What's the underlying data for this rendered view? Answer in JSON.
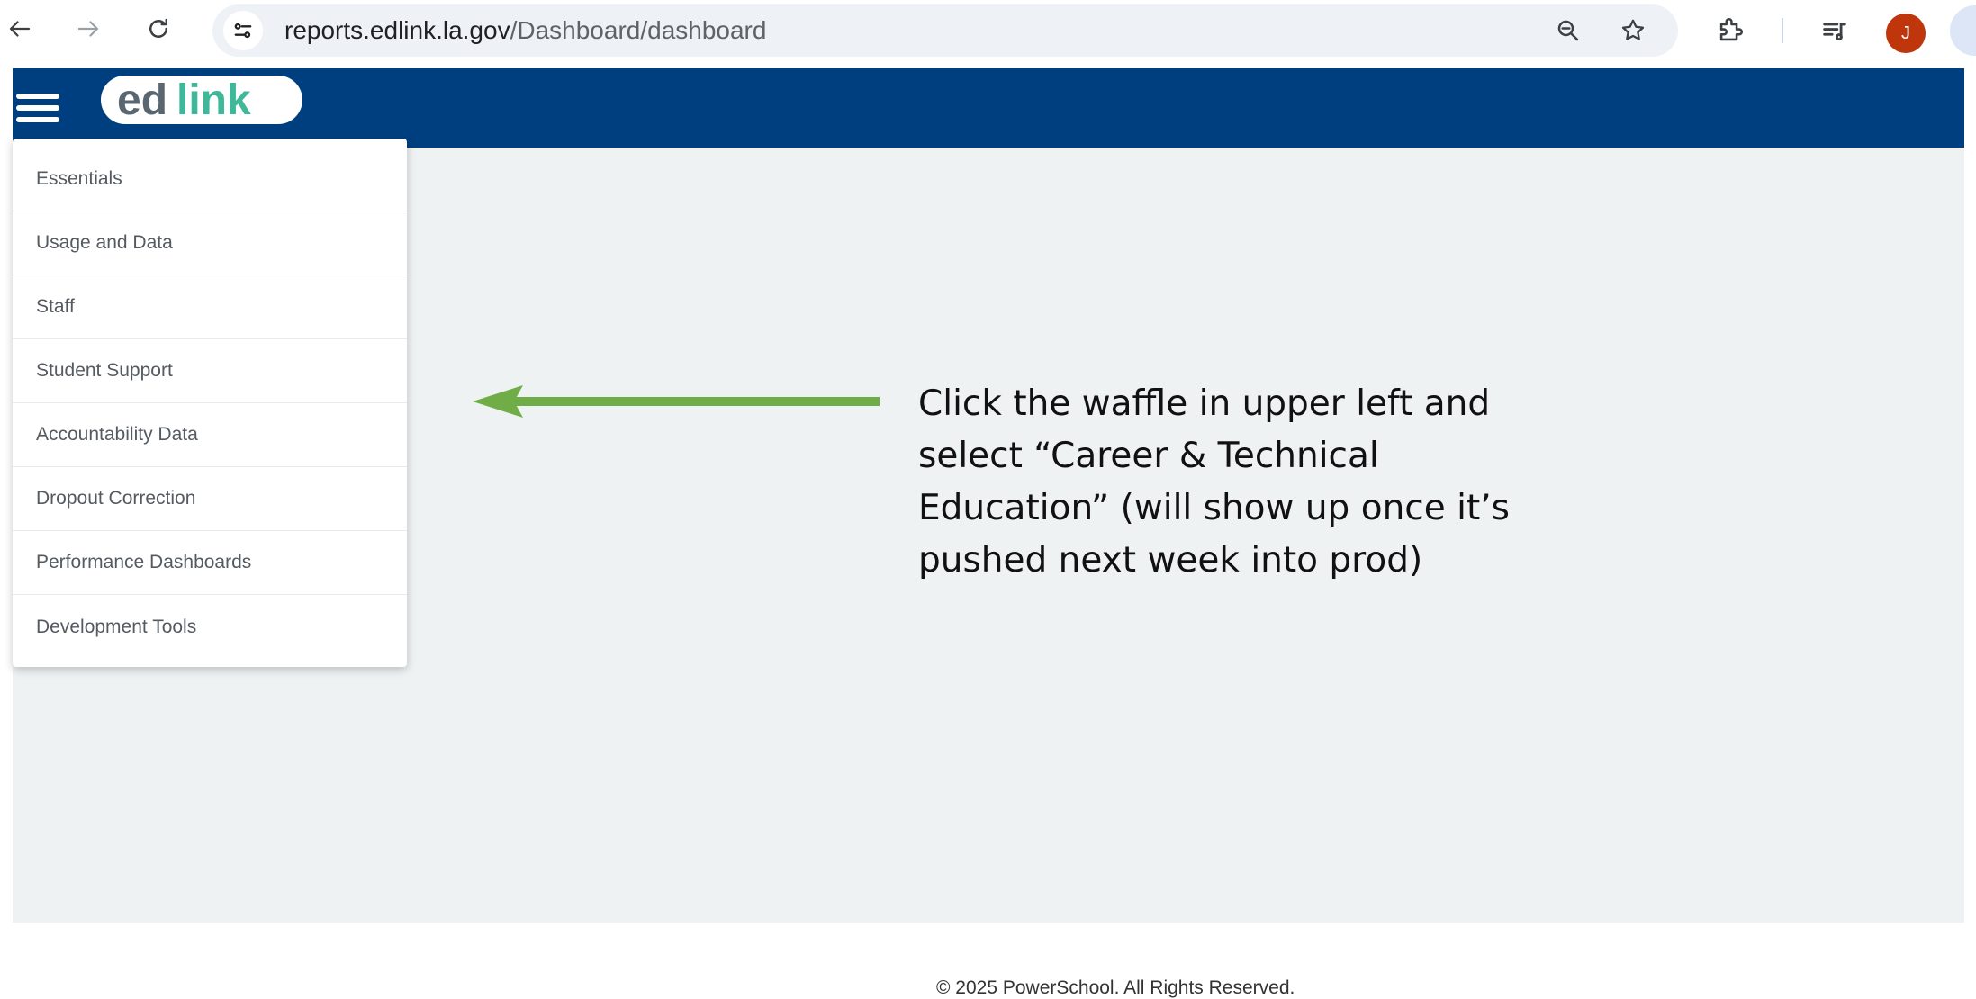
{
  "browser": {
    "url_host": "reports.edlink.la.gov",
    "url_path": "/Dashboard/dashboard",
    "profile_initial": "J",
    "icons": [
      "back-arrow-icon",
      "forward-arrow-icon",
      "reload-icon",
      "site-settings-icon",
      "zoom-out-icon",
      "star-icon",
      "extensions-icon",
      "media-queue-icon"
    ]
  },
  "app": {
    "logo_text": "edlink",
    "menu": {
      "items": [
        {
          "label": "Essentials"
        },
        {
          "label": "Usage and Data"
        },
        {
          "label": "Staff"
        },
        {
          "label": "Student Support"
        },
        {
          "label": "Accountability Data"
        },
        {
          "label": "Dropout Correction"
        },
        {
          "label": "Performance Dashboards"
        },
        {
          "label": "Development Tools"
        }
      ]
    },
    "footer": "© 2025 PowerSchool. All Rights Reserved."
  },
  "annotation": {
    "text": "Click the waffle in upper left and select “Career & Technical Education”  (will show up once it’s pushed next week into prod)",
    "arrow_color": "#70ad47"
  },
  "colors": {
    "header_bg": "#003f7f",
    "page_bg": "#eef2f3",
    "avatar_bg": "#c0360c"
  }
}
